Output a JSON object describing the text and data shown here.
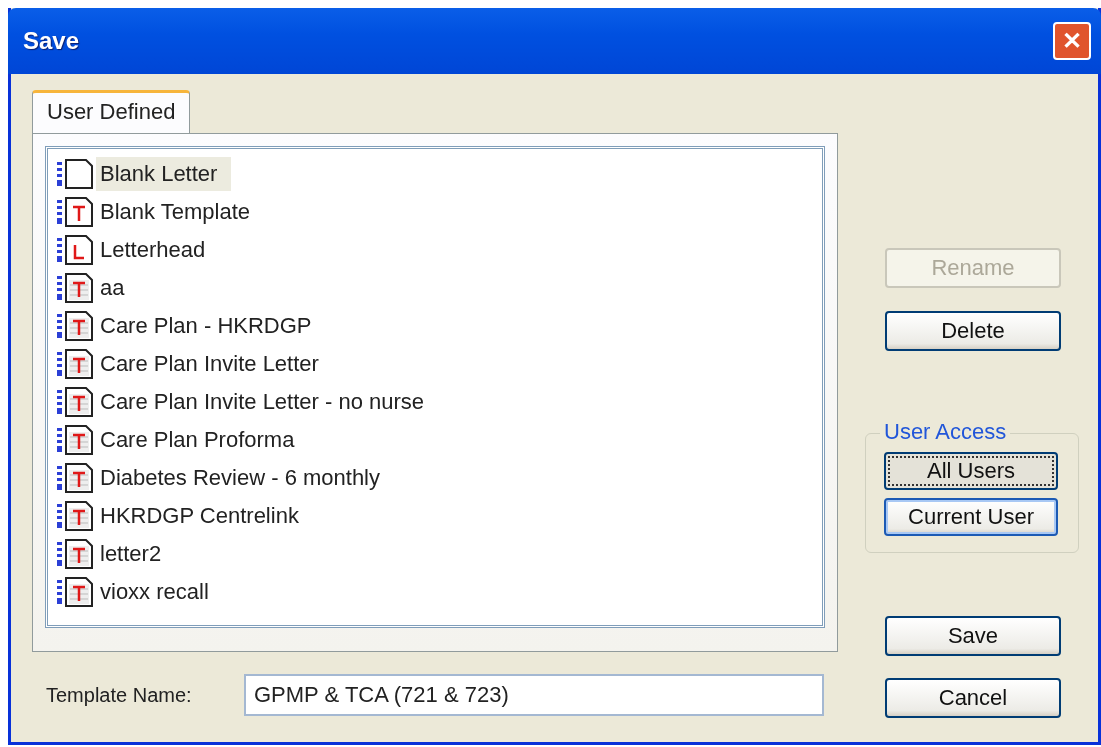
{
  "window": {
    "title": "Save",
    "close_label": "✕"
  },
  "tabs": [
    {
      "label": "User Defined",
      "selected": true
    }
  ],
  "templates": [
    {
      "name": "Blank Letter",
      "kind": "blank",
      "selected": true
    },
    {
      "name": "Blank Template",
      "kind": "template",
      "selected": false
    },
    {
      "name": "Letterhead",
      "kind": "letterhead",
      "selected": false
    },
    {
      "name": "aa",
      "kind": "document",
      "selected": false
    },
    {
      "name": "Care Plan - HKRDGP",
      "kind": "document",
      "selected": false
    },
    {
      "name": "Care Plan Invite Letter",
      "kind": "document",
      "selected": false
    },
    {
      "name": "Care Plan Invite Letter - no nurse",
      "kind": "document",
      "selected": false
    },
    {
      "name": "Care Plan Proforma",
      "kind": "document",
      "selected": false
    },
    {
      "name": "Diabetes Review - 6 monthly",
      "kind": "document",
      "selected": false
    },
    {
      "name": "HKRDGP Centrelink",
      "kind": "document",
      "selected": false
    },
    {
      "name": "letter2",
      "kind": "document",
      "selected": false
    },
    {
      "name": "vioxx recall",
      "kind": "document",
      "selected": false
    }
  ],
  "template_name": {
    "label": "Template Name:",
    "value": "GPMP & TCA (721 & 723)"
  },
  "side_buttons": [
    {
      "label": "Rename",
      "disabled": true
    },
    {
      "label": "Delete",
      "disabled": false
    }
  ],
  "user_access": {
    "title": "User Access",
    "buttons": [
      {
        "label": "All Users",
        "focused": true
      },
      {
        "label": "Current User",
        "focused": false
      }
    ]
  },
  "dialog_buttons": [
    {
      "label": "Save"
    },
    {
      "label": "Cancel"
    }
  ]
}
